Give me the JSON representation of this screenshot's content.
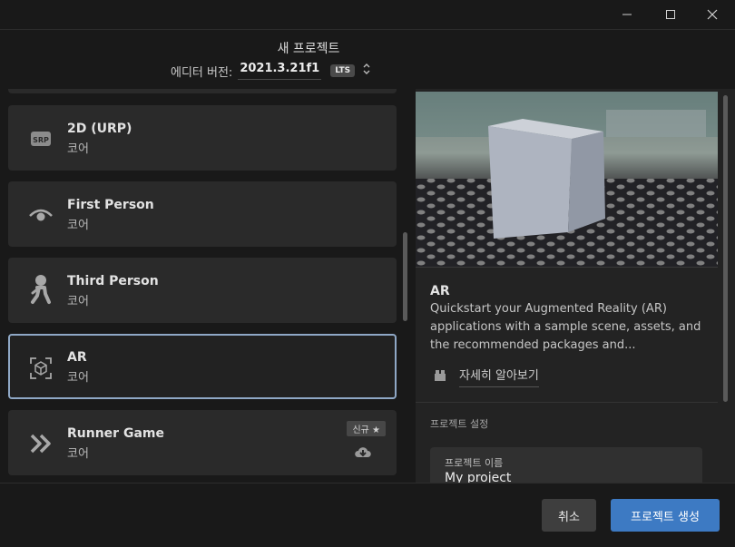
{
  "header": {
    "title": "새 프로젝트",
    "editor_label": "에디터 버전:",
    "editor_version": "2021.3.21f1",
    "lts_badge": "LTS"
  },
  "templates": [
    {
      "name": "2D (URP)",
      "category": "코어",
      "icon": "srp-icon",
      "icon_text": "SRP"
    },
    {
      "name": "First Person",
      "category": "코어",
      "icon": "eye-icon"
    },
    {
      "name": "Third Person",
      "category": "코어",
      "icon": "running-person-icon"
    },
    {
      "name": "AR",
      "category": "코어",
      "icon": "ar-cube-icon",
      "selected": true
    },
    {
      "name": "Runner Game",
      "category": "코어",
      "icon": "double-chevron-icon",
      "badge": "신규 ★",
      "download": true
    }
  ],
  "details": {
    "name": "AR",
    "description": "Quickstart your Augmented Reality (AR) applications with a sample scene, assets, and the recommended packages and...",
    "learn_more": "자세히 알아보기",
    "settings_header": "프로젝트 설정",
    "project_name_label": "프로젝트 이름",
    "project_name_value": "My project"
  },
  "footer": {
    "cancel": "취소",
    "create": "프로젝트 생성"
  },
  "colors": {
    "background": "#191919",
    "card": "#2a2a2a",
    "selected_border": "#8fa8c6",
    "primary_button": "#3d7ac3"
  }
}
